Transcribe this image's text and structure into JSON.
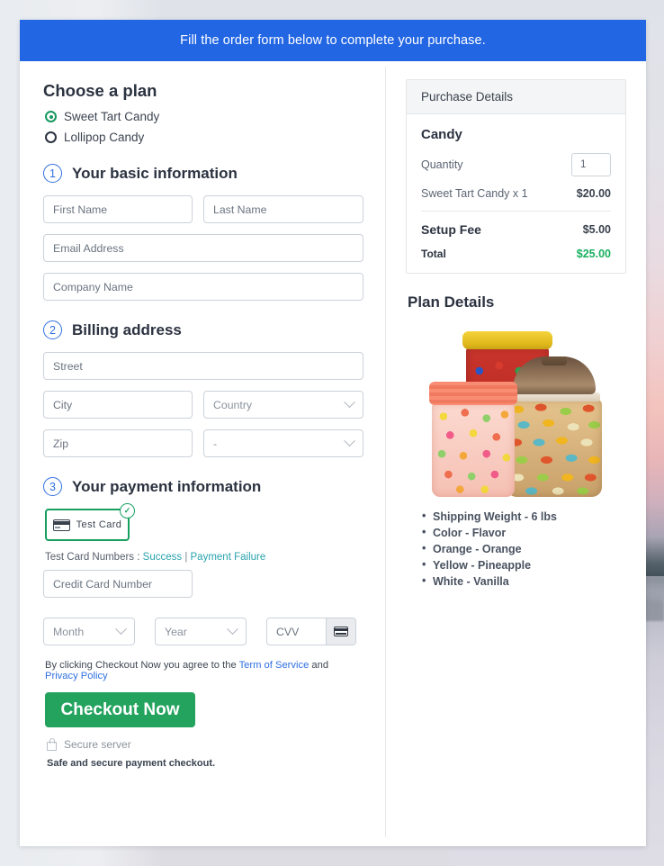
{
  "banner": {
    "text": "Fill the order form below to complete your purchase."
  },
  "plan": {
    "heading": "Choose a plan",
    "options": [
      {
        "label": "Sweet Tart Candy",
        "selected": true
      },
      {
        "label": "Lollipop Candy",
        "selected": false
      }
    ]
  },
  "steps": {
    "basic": {
      "number": "1",
      "title": "Your basic information"
    },
    "billing": {
      "number": "2",
      "title": "Billing address"
    },
    "payment": {
      "number": "3",
      "title": "Your payment information"
    }
  },
  "fields": {
    "first_name": "First Name",
    "last_name": "Last Name",
    "email": "Email Address",
    "company": "Company Name",
    "street": "Street",
    "city": "City",
    "country": "Country",
    "zip": "Zip",
    "state": "-",
    "credit_card": "Credit Card Number",
    "month": "Month",
    "year": "Year",
    "cvv": "CVV"
  },
  "payment": {
    "method_label": "Test Card",
    "method_selected": true,
    "check_glyph": "✓",
    "test_prefix": "Test Card Numbers : ",
    "test_success": "Success",
    "test_separator": " | ",
    "test_failure": "Payment Failure"
  },
  "footer": {
    "terms_prefix": "By clicking Checkout Now you agree to the ",
    "terms_link": "Term of Service",
    "terms_and": " and ",
    "privacy_link": "Privacy Policy",
    "checkout_label": "Checkout Now",
    "secure_server": "Secure server",
    "safe_note": "Safe and secure payment checkout."
  },
  "purchase": {
    "panel_title": "Purchase Details",
    "product_title": "Candy",
    "quantity_label": "Quantity",
    "quantity_value": "1",
    "line_item_label": "Sweet Tart Candy x 1",
    "line_item_price": "$20.00",
    "setup_fee_label": "Setup Fee",
    "setup_fee_price": "$5.00",
    "total_label": "Total",
    "total_price": "$25.00"
  },
  "plan_details": {
    "heading": "Plan Details",
    "bullets": [
      "Shipping Weight - 6 lbs",
      "Color - Flavor",
      "Orange - Orange",
      "Yellow - Pineapple",
      "White - Vanilla"
    ]
  },
  "colors": {
    "banner_blue": "#2266e3",
    "accent_green": "#17a05f",
    "checkout_green": "#23a35e",
    "total_green": "#19b05f",
    "link_blue": "#2f6fe0",
    "link_teal": "#29a3ae",
    "step_blue": "#2f6fe0"
  }
}
